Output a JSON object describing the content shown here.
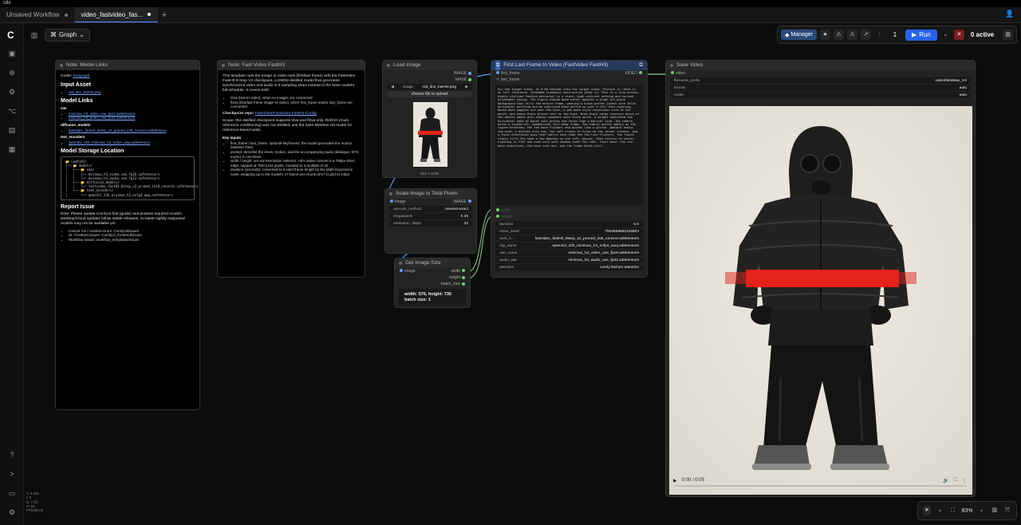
{
  "titlebar": {
    "app": "Idle"
  },
  "tabs": [
    {
      "label": "Unsaved Workflow"
    },
    {
      "label": "video_fastvideo_fas..."
    }
  ],
  "toolbar": {
    "graph_label": "Graph"
  },
  "actionbar": {
    "manager_label": "Manager",
    "queue_count": "1",
    "run_label": "Run",
    "active_label": "0 active"
  },
  "nodes": {
    "model_links": {
      "title": "Note: Model Links",
      "guide_label": "Guide:",
      "guide_link": "Subgraph",
      "input_asset_heading": "Input Asset",
      "input_asset_file": "red_line_barrier.png",
      "model_links_heading": "Model Links",
      "vae_label": "vae",
      "vae_files": [
        "minimax_h3_video_vae_fp16.safetensors",
        "minimax_h3_audio_vae_fp32.safetensors"
      ],
      "diffusion_label": "diffusion_models",
      "diffusion_files": [
        "fastvideo_fastH3_8step_v2_pruned_int8_convrot.safetensors"
      ],
      "text_encoders_label": "text_encoders",
      "text_encoder_files": [
        "qwen3vl_32b_minimax_h3_nvfp4_awq.safetensors"
      ],
      "storage_heading": "Model Storage Location",
      "storage_tree": "📂 ComfyUI/\n├── 📂 models/\n│   ├── 📂 vae/\n│   │   ├── minimax_h3_video_vae_fp16.safetensors\n│   │   └── minimax_h3_audio_vae_fp32.safetensors\n│   ├── 📂 diffusion_models/\n│   │   └── fastvideo_fastH3_8step_v2_pruned_int8_convrot.safetensors\n│   └── 📂 text_encoders/\n│       └── qwen3vl_32b_minimax_h3_nvfp4_awq.safetensors",
      "report_heading": "Report Issue",
      "report_text": "Note: Please update ComfyUI first (guide) and prepare required models. Desktop/Cloud updates follow stable releases, so latest nightly-supported models may not be available yet.",
      "report_items": [
        "Cannot run / runtime errors: ComfyUI/issues",
        "UI / frontend issues: ComfyUI_frontend/issues",
        "Workflow issues: workflow_templates/issues"
      ]
    },
    "fast_video": {
      "title": "Note: Fast Video FastH3",
      "intro": "This template runs the Image to Video task (first/last frame) with the FastVideo FastH3 8-Step V2 checkpoint, a DMD2-distilled model that generates synchronized video and audio in 8 sampling steps instead of the base model's full schedule. It covers both:",
      "modes": [
        "t2va (text-to-video), when no images are connected",
        "fl2va (first/last frame image-to-video), when first_frame and/or last_frame are connected"
      ],
      "checkpoint_label": "Checkpoint repo:",
      "checkpoint_link": "FastVideo/FastVideo-FastH3-Config",
      "scope": "Scope: this distilled checkpoint supports t2va and fl2va only. Ref2VA (multi-reference conditioning) was not distilled; use the base MiniMax H3 model for reference-based tasks.",
      "key_inputs_heading": "Key inputs",
      "key_inputs": [
        "first_frame / last_frame: optional keyframes; the model generates the motion between them",
        "prompt: describe the shots, motion, and the accompanying audio (dialogue, SFX, music) in one block",
        "width / height: set via Resolution Selector. H3's native canvas is a 768px short edge, capped at 768×1344 pixels, rounded to a multiple of 32",
        "duration (seconds): converted to a valid frame length by the Math Expression node, snapping up to the model's 17-frame-per-chunk (8*n+1) grid at 24fps"
      ]
    },
    "load_image": {
      "title": "Load Image",
      "out_image": "IMAGE",
      "out_mask": "MASK",
      "image_label": "image",
      "image_value": "red_line_barrier.png",
      "upload_label": "choose file to upload",
      "caption": "864 × 1536"
    },
    "scale_image": {
      "title": "Scale Image to Total Pixels",
      "in_image": "image",
      "out_image": "IMAGE",
      "widgets": [
        {
          "label": "upscale_method",
          "value": "nearest-exact"
        },
        {
          "label": "megapixels",
          "value": "0.45"
        },
        {
          "label": "resolution_steps",
          "value": "32"
        }
      ]
    },
    "get_size": {
      "title": "Get Image Size",
      "in_image": "image",
      "out_width": "width",
      "out_height": "height",
      "out_batch": "batch_size",
      "info_line1": "width: 576, height: 736",
      "info_line2": "batch size: 1"
    },
    "first_last": {
      "title": "First Last Frame to Video (FastVideo FastH3)",
      "in_first": "first_frame",
      "in_last": "last_frame",
      "out_video": "VIDEO",
      "prompt": "For the target scene, at 0.00 seconds into the target scene, Picture in (Shot 1) in full reference. Intended cinematic description [Shot 1]: This is a live-action, highly stylized fashion editorial in a stark, high-contrast setting and surreal streetwear energy. The figure stands dead center against a clean off-white background that fills the entire frame, wearing a black puffer jacket with thick horizontal quilting and an oversized hood pulled up over a full face covering. Round dark goggles sit over the eyes, a gas-mask style respirator sits at the mouth, and heavy black gloves rest on the hips. Wide black cargo trousers bunch at the ankles above grey chunky sneakers with thick soles. A bright saturated red horizontal band of paint cuts across the torso like a barrier line. The camera holds a locked-off, symmetrical full-body frame. The fabric shifts subtly as the figure breathes; the red band flickers and pulses like a glitch. Ambient audio: low wind, a distant city hum, the soft crunch of nylon as the jacket creases, and a faint electronic buzz that swells each time the red line flickers. The figure slowly tilts the head a few degrees to the left, pauses, then returns to center. Lighting is flat and even with soft shadow under the feet. Final beat: the red band stabilizes, the buzz cuts out, and the frame holds still.",
      "in_width": "width",
      "in_height": "height",
      "widgets": [
        {
          "label": "duration",
          "value": "5.0"
        },
        {
          "label": "noise_seed",
          "value": "7933669882225504"
        },
        {
          "label": "unet_n...",
          "value": "fastvideo_fastH3_8step_v2_pruned_int8_convrot.safetensors"
        },
        {
          "label": "clip_name",
          "value": "qwen3vl_32b_minimax_h3_nvfp4_awq.safetensors"
        },
        {
          "label": "vae_name",
          "value": "minimax_h3_video_vae_fp16.safetensors"
        },
        {
          "label": "audio_vae",
          "value": "minimax_h3_audio_vae_fp32.safetensors"
        },
        {
          "label": "attention",
          "value": "comfy kitchen attention"
        }
      ]
    },
    "save_video": {
      "title": "Save Video",
      "in_video": "video",
      "widgets": [
        {
          "label": "filename_prefix",
          "value": "video/MiniMax_H3"
        },
        {
          "label": "format",
          "value": "auto"
        },
        {
          "label": "codec",
          "value": "auto"
        }
      ],
      "time": "0:00 / 0:05",
      "progress": 0.0
    }
  },
  "stats": "T: 0.00s\nI: 0\nN: 7 [7]\nV: 15\nFPS:60.02",
  "canvas_controls": {
    "zoom": "83%"
  },
  "colors": {
    "accent": "#2563eb",
    "link": "#64a0ff",
    "red_band": "#e4231c",
    "bg": "#0c0c0c"
  }
}
